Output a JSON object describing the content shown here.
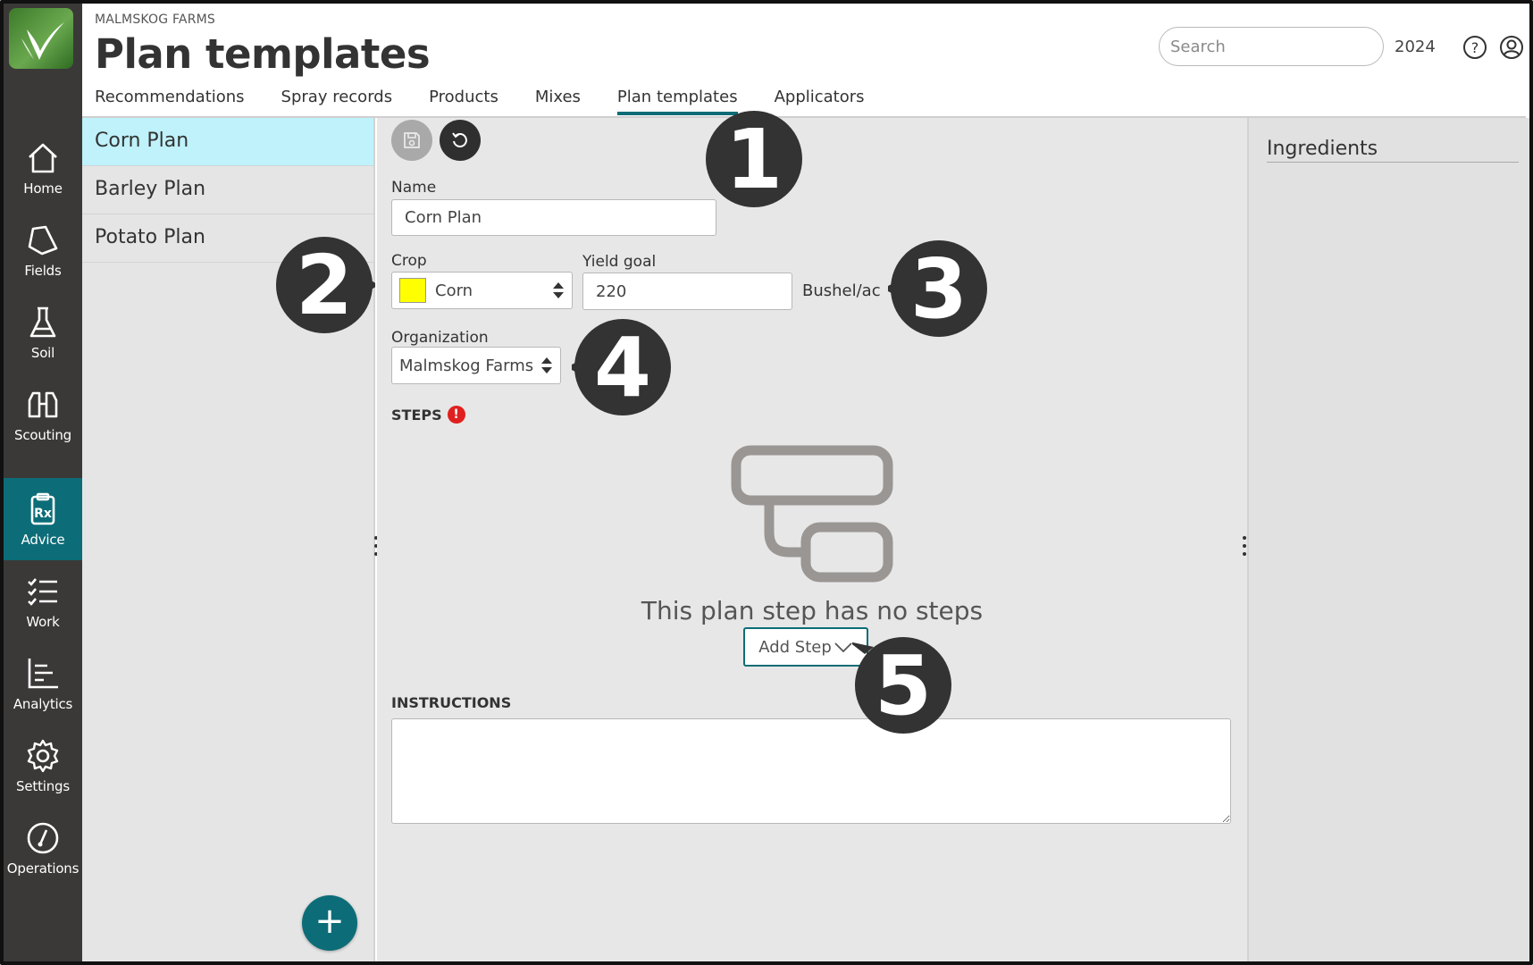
{
  "app": {
    "org_name": "MALMSKOG FARMS",
    "page_title": "Plan templates"
  },
  "header": {
    "search_placeholder": "Search",
    "year": "2024"
  },
  "tabs": [
    {
      "label": "Recommendations"
    },
    {
      "label": "Spray records"
    },
    {
      "label": "Products"
    },
    {
      "label": "Mixes"
    },
    {
      "label": "Plan templates",
      "active": true
    },
    {
      "label": "Applicators"
    }
  ],
  "nav": [
    {
      "label": "Home",
      "icon": "home-icon"
    },
    {
      "label": "Fields",
      "icon": "fields-icon"
    },
    {
      "label": "Soil",
      "icon": "flask-icon"
    },
    {
      "label": "Scouting",
      "icon": "binoculars-icon"
    },
    {
      "label": "Advice",
      "icon": "prescription-icon",
      "active": true
    },
    {
      "label": "Work",
      "icon": "checklist-icon"
    },
    {
      "label": "Analytics",
      "icon": "chart-icon"
    },
    {
      "label": "Settings",
      "icon": "gear-icon"
    },
    {
      "label": "Operations",
      "icon": "gauge-icon"
    }
  ],
  "plans": [
    {
      "label": "Corn Plan",
      "selected": true
    },
    {
      "label": "Barley Plan"
    },
    {
      "label": "Potato Plan"
    }
  ],
  "form": {
    "name_label": "Name",
    "name_value": "Corn Plan",
    "crop_label": "Crop",
    "crop_value": "Corn",
    "crop_color": "#ffff00",
    "yield_label": "Yield goal",
    "yield_value": "220",
    "yield_unit": "Bushel/ac",
    "org_label": "Organization",
    "org_value": "Malmskog Farms",
    "steps_label": "STEPS",
    "steps_alert": "!",
    "empty_message": "This plan step has no steps",
    "add_step_label": "Add Step",
    "instructions_label": "INSTRUCTIONS",
    "instructions_value": ""
  },
  "ingredients": {
    "title": "Ingredients"
  },
  "callouts": [
    "1",
    "2",
    "3",
    "4",
    "5"
  ],
  "colors": {
    "rail": "#3b3938",
    "accent": "#0c6d78",
    "selected_row": "#bff2fb",
    "alert": "#e0201e",
    "callout": "#333333"
  }
}
